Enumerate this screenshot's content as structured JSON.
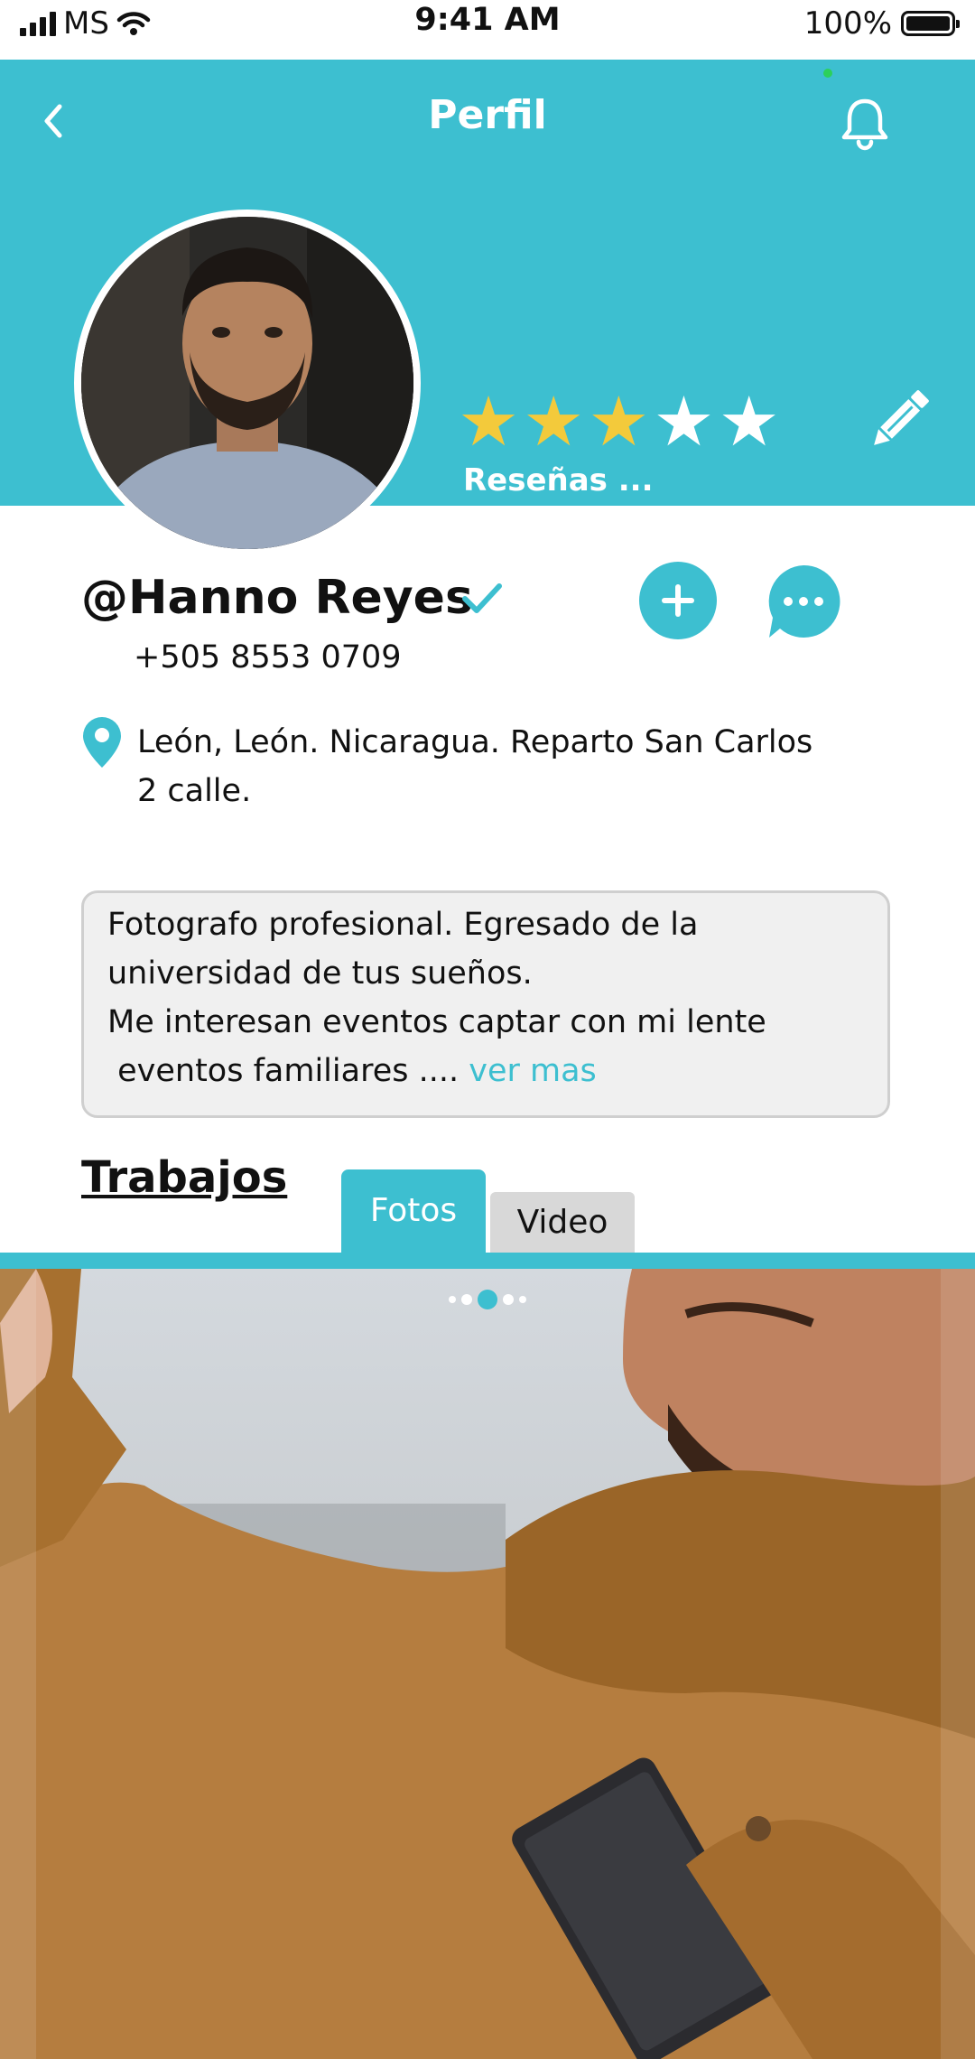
{
  "status_bar": {
    "carrier": "MS",
    "time": "9:41 AM",
    "battery": "100%"
  },
  "header": {
    "title": "Perfil",
    "rating": 3,
    "max_rating": 5,
    "reviews_label": "Reseñas ..."
  },
  "profile": {
    "username": "@Hanno Reyes",
    "phone": "+505 8553 0709",
    "address_line1": "León, León. Nicaragua. Reparto San Carlos",
    "address_line2": "2 calle."
  },
  "bio": {
    "line1": "Fotografo profesional. Egresado de la",
    "line2": "universidad de tus sueños.",
    "line3": "Me interesan eventos captar con mi lente",
    "line4": " eventos familiares ....",
    "more_link": "ver mas"
  },
  "works": {
    "title": "Trabajos",
    "tabs": [
      {
        "label": "Fotos",
        "active": true
      },
      {
        "label": "Video",
        "active": false
      }
    ],
    "carousel": {
      "total": 5,
      "active_index": 2
    }
  },
  "colors": {
    "accent": "#3dbfd0",
    "star": "#f3ca3b",
    "notification_dot": "#2cd05b"
  },
  "icons": [
    "back-icon",
    "bell-icon",
    "edit-icon",
    "verified-icon",
    "add-icon",
    "chat-icon",
    "location-icon"
  ]
}
